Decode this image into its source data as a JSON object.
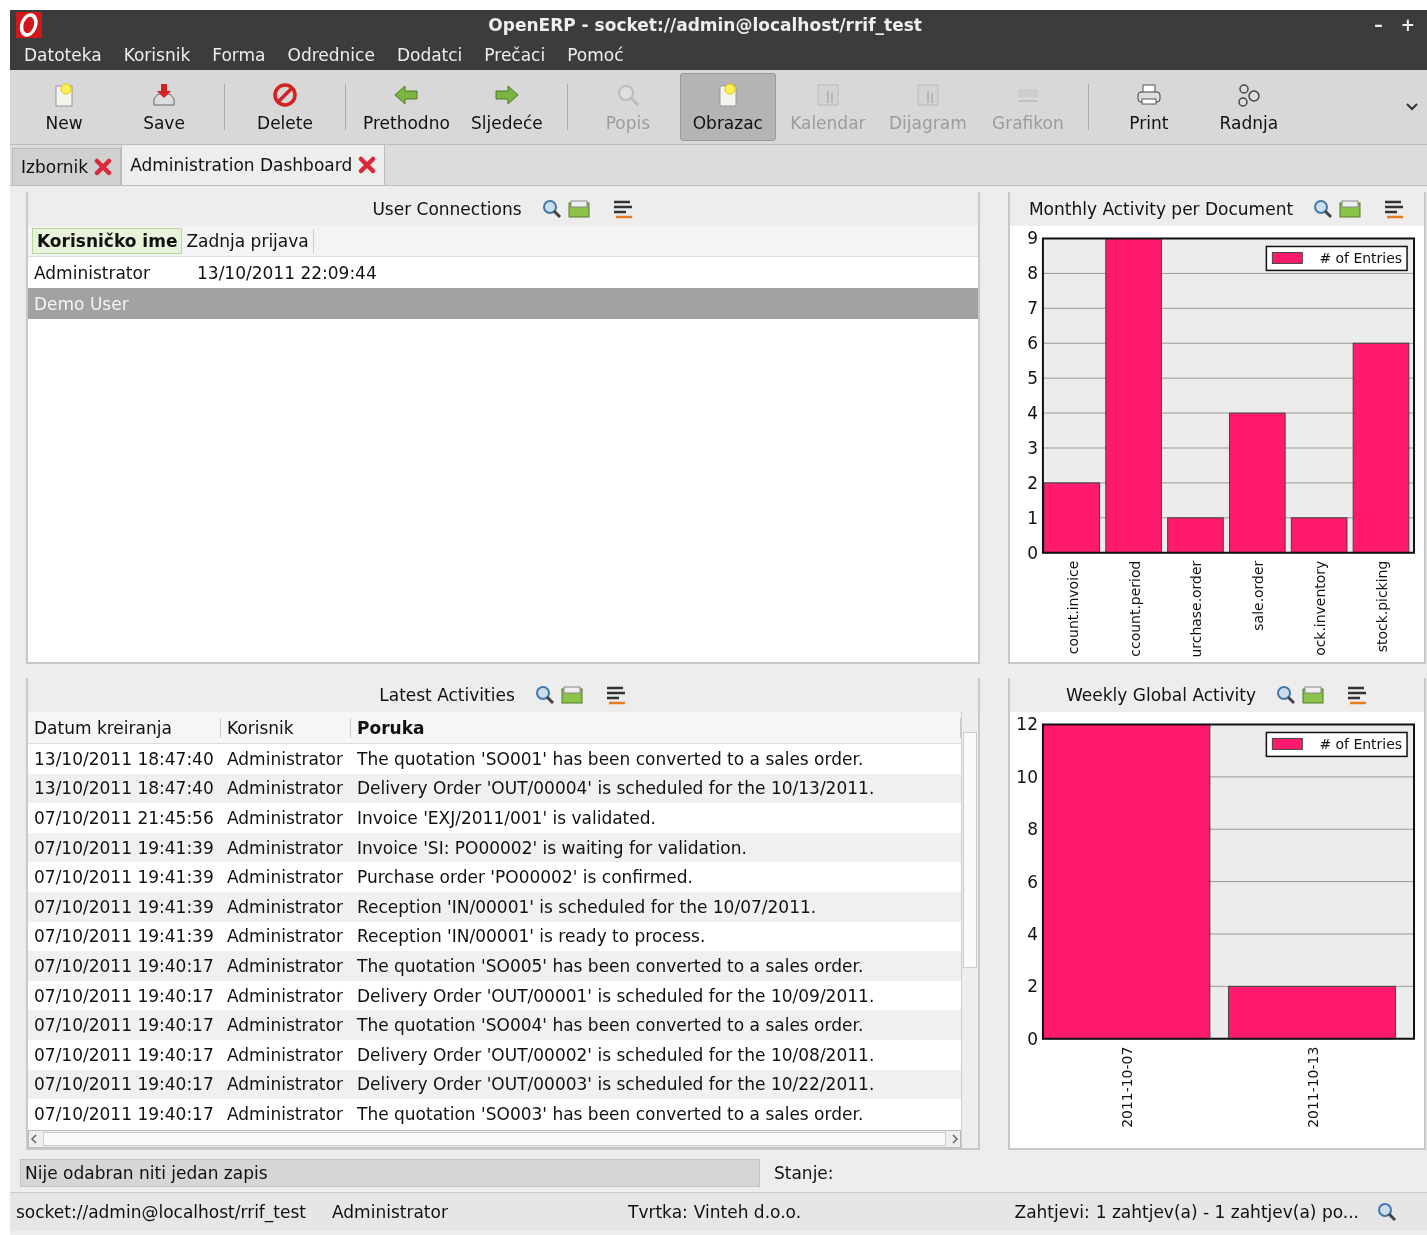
{
  "window": {
    "title": "OpenERP - socket://admin@localhost/rrif_test",
    "controls": [
      "–",
      "+"
    ]
  },
  "menu": [
    "Datoteka",
    "Korisnik",
    "Forma",
    "Odrednice",
    "Dodatci",
    "Prečaci",
    "Pomoć"
  ],
  "toolbar": [
    [
      {
        "label": "New",
        "kind": "new",
        "disabled": false,
        "selected": false
      },
      {
        "label": "Save",
        "kind": "save",
        "disabled": false,
        "selected": false
      }
    ],
    [
      {
        "label": "Delete",
        "kind": "delete",
        "disabled": false,
        "selected": false
      }
    ],
    [
      {
        "label": "Prethodno",
        "kind": "back",
        "disabled": false,
        "selected": false
      },
      {
        "label": "Sljedeće",
        "kind": "forward",
        "disabled": false,
        "selected": false
      }
    ],
    [
      {
        "label": "Popis",
        "kind": "list",
        "disabled": true,
        "selected": false
      },
      {
        "label": "Obrazac",
        "kind": "form",
        "disabled": false,
        "selected": true
      },
      {
        "label": "Kalendar",
        "kind": "calendar",
        "disabled": true,
        "selected": false
      },
      {
        "label": "Dijagram",
        "kind": "diagram",
        "disabled": true,
        "selected": false
      },
      {
        "label": "Grafikon",
        "kind": "graph",
        "disabled": true,
        "selected": false
      }
    ],
    [
      {
        "label": "Print",
        "kind": "print",
        "disabled": false,
        "selected": false
      },
      {
        "label": "Radnja",
        "kind": "action",
        "disabled": false,
        "selected": false
      }
    ]
  ],
  "tabs": [
    {
      "label": "Izbornik",
      "selected": false
    },
    {
      "label": "Administration Dashboard",
      "selected": true
    }
  ],
  "user_connections": {
    "title": "User Connections",
    "columns": [
      {
        "label": "Korisničko ime",
        "sorted": true,
        "focused": true
      },
      {
        "label": "Zadnja prijava",
        "sorted": false,
        "focused": false
      }
    ],
    "rows": [
      {
        "cells": [
          "Administrator",
          "13/10/2011 22:09:44"
        ],
        "selected": false
      },
      {
        "cells": [
          "Demo User"
        ],
        "selected": true
      }
    ]
  },
  "latest_activities": {
    "title": "Latest Activities",
    "columns": [
      {
        "label": "Datum kreiranja",
        "sorted": false
      },
      {
        "label": "Korisnik",
        "sorted": false
      },
      {
        "label": "Poruka",
        "sorted": true
      }
    ],
    "rows": [
      [
        "13/10/2011 18:47:40",
        "Administrator",
        "The quotation 'SO001' has been converted to a sales order."
      ],
      [
        "13/10/2011 18:47:40",
        "Administrator",
        "Delivery Order 'OUT/00004' is scheduled for the 10/13/2011."
      ],
      [
        "07/10/2011 21:45:56",
        "Administrator",
        "Invoice  'EXJ/2011/001' is validated."
      ],
      [
        "07/10/2011 19:41:39",
        "Administrator",
        "Invoice 'SI: PO00002' is waiting for validation."
      ],
      [
        "07/10/2011 19:41:39",
        "Administrator",
        "Purchase order 'PO00002' is confirmed."
      ],
      [
        "07/10/2011 19:41:39",
        "Administrator",
        "Reception 'IN/00001' is scheduled for the 10/07/2011."
      ],
      [
        "07/10/2011 19:41:39",
        "Administrator",
        "Reception 'IN/00001' is ready to process."
      ],
      [
        "07/10/2011 19:40:17",
        "Administrator",
        "The quotation 'SO005' has been converted to a sales order."
      ],
      [
        "07/10/2011 19:40:17",
        "Administrator",
        "Delivery Order 'OUT/00001' is scheduled for the 10/09/2011."
      ],
      [
        "07/10/2011 19:40:17",
        "Administrator",
        "The quotation 'SO004' has been converted to a sales order."
      ],
      [
        "07/10/2011 19:40:17",
        "Administrator",
        "Delivery Order 'OUT/00002' is scheduled for the 10/08/2011."
      ],
      [
        "07/10/2011 19:40:17",
        "Administrator",
        "Delivery Order 'OUT/00003' is scheduled for the 10/22/2011."
      ],
      [
        "07/10/2011 19:40:17",
        "Administrator",
        "The quotation 'SO003' has been converted to a sales order."
      ]
    ]
  },
  "monthly_activity": {
    "title": "Monthly Activity per Document",
    "chart_data": {
      "type": "bar",
      "categories": [
        "count.invoice",
        "ccount.period",
        "urchase.order",
        "sale.order",
        "ock.inventory",
        "stock.picking"
      ],
      "series": [
        {
          "name": "# of Entries",
          "color": "#ff1a6e",
          "values": [
            2,
            9,
            1,
            4,
            1,
            6
          ]
        }
      ],
      "ylim": [
        0,
        9
      ],
      "yticks": [
        0,
        1,
        2,
        3,
        4,
        5,
        6,
        7,
        8,
        9
      ],
      "grid": true
    }
  },
  "weekly_activity": {
    "title": "Weekly Global Activity",
    "chart_data": {
      "type": "bar",
      "categories": [
        "2011-10-07",
        "2011-10-13"
      ],
      "series": [
        {
          "name": "# of Entries",
          "color": "#ff1a6e",
          "values": [
            12,
            2
          ]
        }
      ],
      "ylim": [
        0,
        12
      ],
      "yticks": [
        0,
        2,
        4,
        6,
        8,
        10,
        12
      ],
      "grid": true
    }
  },
  "record_status": {
    "message": "Nije odabran niti jedan zapis",
    "state_label": "Stanje:"
  },
  "status_bar": {
    "connection": "socket://admin@localhost/rrif_test",
    "user": "Administrator",
    "company_label": "Tvrtka:",
    "company": "Vinteh d.o.o.",
    "requests_label": "Zahtjevi:",
    "requests": "1 zahtjev(a) - 1 zahtjev(a) po..."
  }
}
